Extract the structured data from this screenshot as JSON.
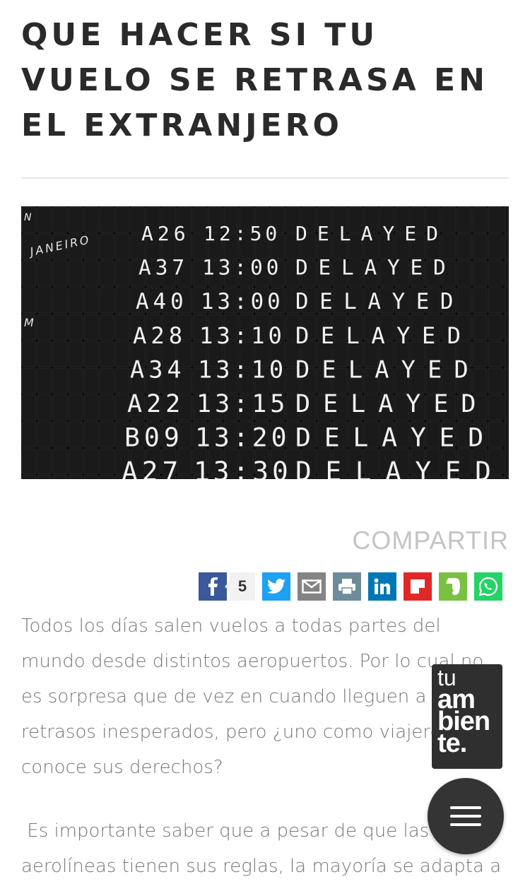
{
  "article": {
    "title": "QUE HACER SI TU VUELO SE RETRASA EN EL EXTRANJERO",
    "paragraph1": "Todos los días salen vuelos a todas partes del mundo desde distintos aeropuertos. Por lo cual no es sorpresa que de vez en cuando lleguen a sufrir retrasos inesperados, pero ¿uno como viajero conoce sus derechos?",
    "paragraph2": " Es importante saber que a pesar de que las aerolíneas tienen sus reglas, la mayoría se adapta a"
  },
  "hero_image": {
    "partial_labels": [
      "N",
      "JANEIRO",
      "M"
    ],
    "rows": [
      {
        "gate": "A26",
        "time": "12:50",
        "status": "DELAYED"
      },
      {
        "gate": "A37",
        "time": "13:00",
        "status": "DELAYED"
      },
      {
        "gate": "A40",
        "time": "13:00",
        "status": "DELAYED"
      },
      {
        "gate": "A28",
        "time": "13:10",
        "status": "DELAYED"
      },
      {
        "gate": "A34",
        "time": "13:10",
        "status": "DELAYED"
      },
      {
        "gate": "A22",
        "time": "13:15",
        "status": "DELAYED"
      },
      {
        "gate": "B09",
        "time": "13:20",
        "status": "DELAYED"
      },
      {
        "gate": "A27",
        "time": "13:30",
        "status": "DELAYED"
      }
    ]
  },
  "share": {
    "label": "COMPARTIR",
    "facebook_count": "5",
    "buttons": [
      {
        "name": "facebook-share-button",
        "icon": "facebook-icon",
        "color": "#3b5998"
      },
      {
        "name": "twitter-share-button",
        "icon": "twitter-icon",
        "color": "#1da1f2"
      },
      {
        "name": "email-share-button",
        "icon": "email-icon",
        "color": "#848484"
      },
      {
        "name": "print-share-button",
        "icon": "print-icon",
        "color": "#6d8b99"
      },
      {
        "name": "linkedin-share-button",
        "icon": "linkedin-icon",
        "color": "#0077b5"
      },
      {
        "name": "flipboard-share-button",
        "icon": "flipboard-icon",
        "color": "#e12828"
      },
      {
        "name": "evernote-share-button",
        "icon": "evernote-icon",
        "color": "#7ac142"
      },
      {
        "name": "whatsapp-share-button",
        "icon": "whatsapp-icon",
        "color": "#25d366"
      }
    ]
  },
  "logo": {
    "line1": "tu",
    "line2": "am",
    "line3": "bien",
    "line4": "te."
  },
  "menu": {
    "icon": "hamburger-icon"
  }
}
